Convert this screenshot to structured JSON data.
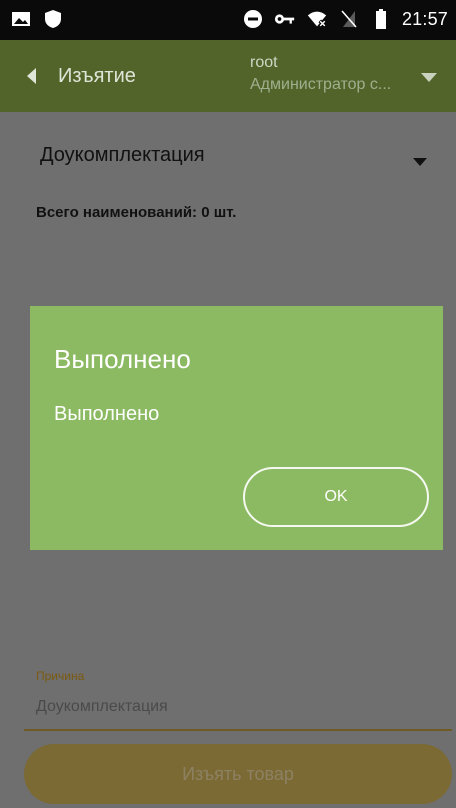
{
  "status_bar": {
    "time": "21:57",
    "icons": [
      "image-icon",
      "shield-icon",
      "do-not-disturb-icon",
      "key-icon",
      "wifi-x-icon",
      "no-sim-icon",
      "battery-icon"
    ]
  },
  "app_bar": {
    "title": "Изъятие",
    "user_name": "root",
    "user_role": "Администратор с..."
  },
  "form": {
    "type_value": "Доукомплектация",
    "total_text": "Всего наименований: 0 шт.",
    "reason_label": "Причина",
    "reason_value": "Доукомплектация",
    "submit_label": "Изъять товар"
  },
  "dialog": {
    "title": "Выполнено",
    "message": "Выполнено",
    "ok_label": "OK"
  },
  "colors": {
    "app_bar": "#52642a",
    "dialog": "#8cba62",
    "dim_background": "#6f6f6f",
    "submit_disabled": "#7b6a34"
  }
}
